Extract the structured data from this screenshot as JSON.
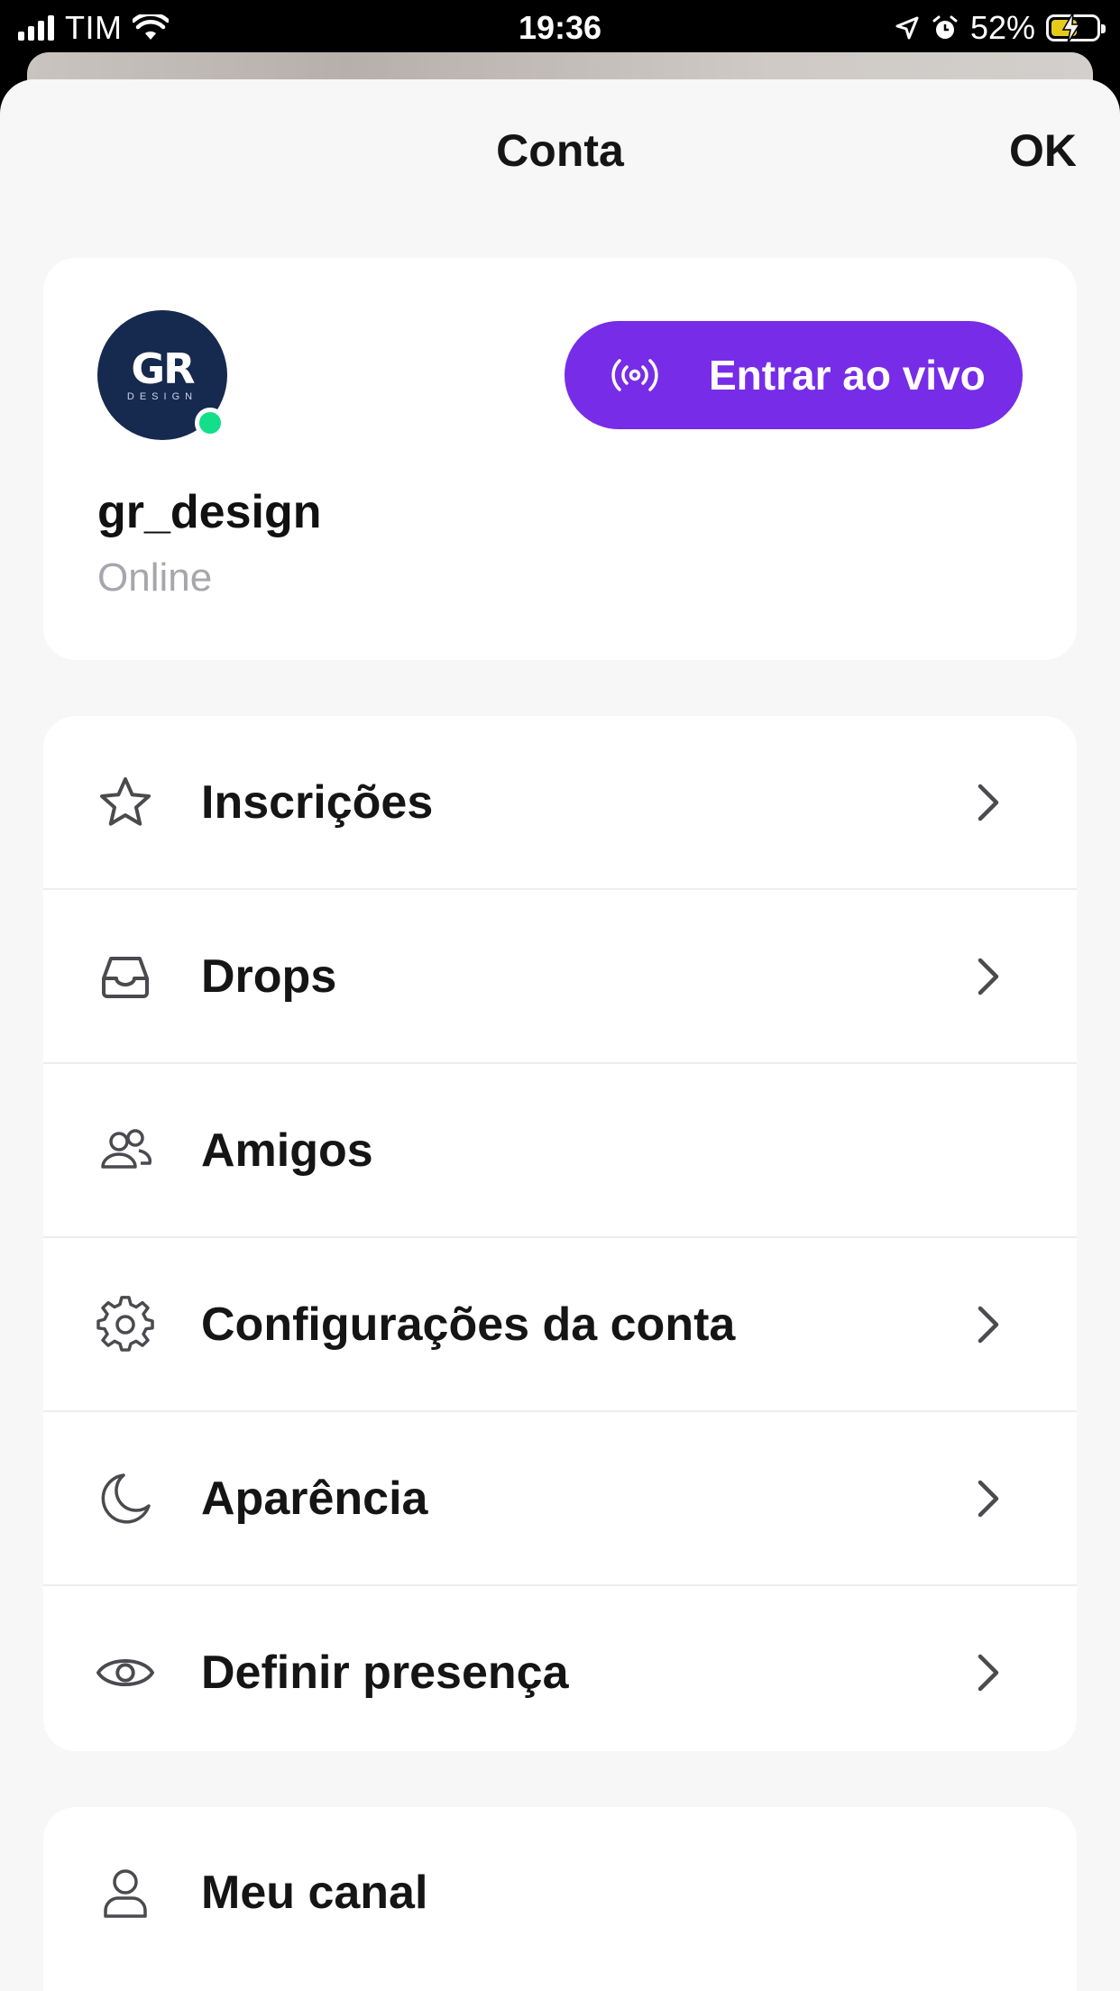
{
  "status_bar": {
    "carrier": "TIM",
    "time": "19:36",
    "battery_percent": "52%"
  },
  "header": {
    "title": "Conta",
    "ok_label": "OK"
  },
  "profile": {
    "avatar_text": "GR",
    "avatar_subtext": "DESIGN",
    "username": "gr_design",
    "status": "Online",
    "live_button_label": "Entrar ao vivo"
  },
  "menu": {
    "items": [
      {
        "label": "Inscrições",
        "icon": "star-icon"
      },
      {
        "label": "Drops",
        "icon": "inbox-icon"
      },
      {
        "label": "Amigos",
        "icon": "friends-icon"
      },
      {
        "label": "Configurações da conta",
        "icon": "gear-icon"
      },
      {
        "label": "Aparência",
        "icon": "moon-icon"
      },
      {
        "label": "Definir presença",
        "icon": "eye-icon"
      }
    ]
  },
  "channel": {
    "label": "Meu canal",
    "icon": "user-icon"
  },
  "colors": {
    "accent": "#772ce8",
    "online": "#13de8a",
    "background": "#f7f7f7"
  }
}
